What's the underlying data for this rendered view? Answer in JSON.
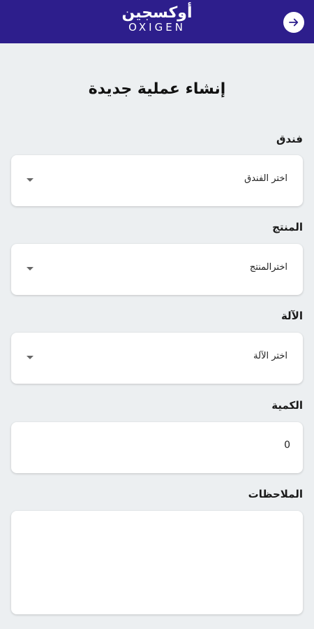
{
  "header": {
    "logo_ar": "أوكسجين",
    "logo_en": "OXIGEN",
    "back_icon": "arrow-right-icon",
    "bg_color": "#2d1e8c"
  },
  "page": {
    "title": "إنشاء عملية جديدة"
  },
  "form": {
    "hotel": {
      "label": "فندق",
      "value": "اختر الفندق"
    },
    "product": {
      "label": "المنتج",
      "value": "اخترالمنتج"
    },
    "machine": {
      "label": "الآلة",
      "value": "اختر الآلة"
    },
    "quantity": {
      "label": "الكمية",
      "value": "0"
    },
    "notes": {
      "label": "الملاحظات",
      "value": ""
    }
  }
}
